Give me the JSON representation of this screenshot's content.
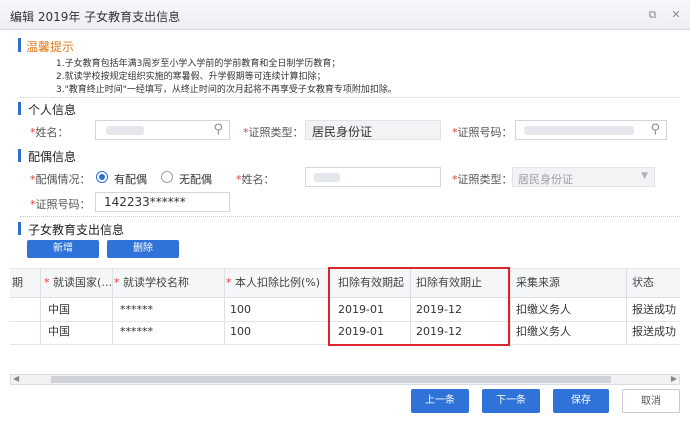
{
  "window": {
    "title": "编辑 2019年 子女教育支出信息",
    "restore_glyph": "⧉",
    "close_glyph": "✕"
  },
  "tips": {
    "title": "温馨提示",
    "lines": [
      "1.子女教育包括年满3周岁至小学入学前的学前教育和全日制学历教育；",
      "2.就读学校按规定组织实施的寒暑假、升学假期等可连续计算扣除；",
      "3.\"教育终止时间\"一经填写，从终止时间的次月起将不再享受子女教育专项附加扣除。"
    ]
  },
  "personal": {
    "section_title": "个人信息",
    "name_label": "姓名：",
    "id_type_label": "证照类型：",
    "id_type_value": "居民身份证",
    "id_number_label": "证照号码："
  },
  "spouse": {
    "section_title": "配偶信息",
    "status_label": "配偶情况：",
    "option_yes": "有配偶",
    "option_no": "无配偶",
    "name_label": "姓名：",
    "id_type_label": "证照类型：",
    "id_type_value": "居民身份证",
    "id_number_label": "证照号码：",
    "id_number_value": "142233******"
  },
  "children": {
    "section_title": "子女教育支出信息",
    "add_label": "新增",
    "delete_label": "删除",
    "columns": [
      "期",
      "就读国家(…",
      "就读学校名称",
      "本人扣除比例(%)",
      "扣除有效期起",
      "扣除有效期止",
      "采集来源",
      "状态"
    ],
    "rows": [
      [
        "",
        "中国",
        "******",
        "100",
        "2019-01",
        "2019-12",
        "扣缴义务人",
        "报送成功"
      ],
      [
        "",
        "中国",
        "******",
        "100",
        "2019-01",
        "2019-12",
        "扣缴义务人",
        "报送成功"
      ]
    ]
  },
  "footer": {
    "prev_label": "上一条",
    "next_label": "下一条",
    "save_label": "保存",
    "cancel_label": "取消"
  },
  "colors": {
    "accent": "#2f73d8",
    "highlight_box": "#d9262a",
    "tips_title": "#e47a1a"
  }
}
